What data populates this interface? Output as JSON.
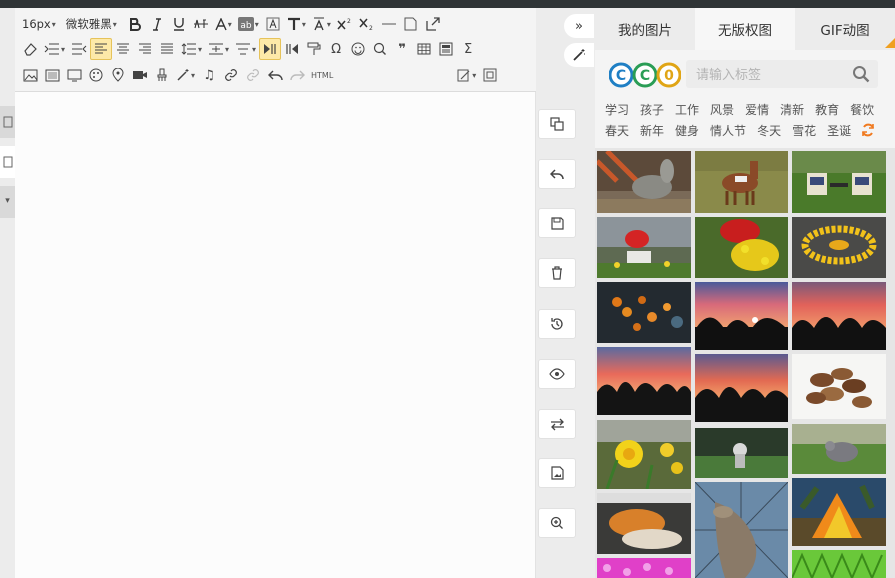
{
  "toolbar": {
    "font_size": "16px",
    "font_family": "微软雅黑",
    "html_label": "HTML"
  },
  "right_panel": {
    "tabs": [
      "我的图片",
      "无版权图",
      "GIF动图"
    ],
    "logo_text": "CC0",
    "search": {
      "placeholder": "请输入标签"
    },
    "tags_row1": [
      "学习",
      "孩子",
      "工作",
      "风景",
      "爱情",
      "清新",
      "教育",
      "餐饮"
    ],
    "tags_row2": [
      "春天",
      "新年",
      "健身",
      "情人节",
      "冬天",
      "雪花",
      "圣诞"
    ]
  },
  "gallery_images": [
    "donkey-photo",
    "pony-photo",
    "garden-chairs-photo",
    "flower-pot-mailbox-photo",
    "red-pot-flowers-photo",
    "flower-circle-photo",
    "orange-berries-photo",
    "sunset-trees-photo",
    "sunset-trees-photo-2",
    "sunset-field-photo",
    "sunset-trees-photo-3",
    "brazil-nuts-photo",
    "daffodils-photo",
    "person-in-field-photo",
    "pigeon-photo",
    "bread-photo",
    "dragon-sculpture-photo",
    "bonfire-photo",
    "pink-flowers-photo",
    "green-plants-photo"
  ],
  "colors": {
    "accent_orange": "#f0a020",
    "active_button": "#fde9a8",
    "topbar": "#2f3436"
  }
}
